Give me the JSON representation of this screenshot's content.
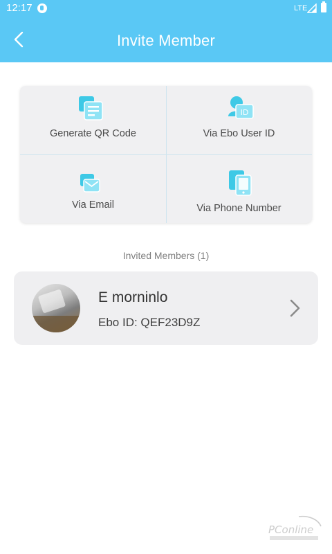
{
  "status_bar": {
    "time": "12:17",
    "network": "LTE",
    "icons": [
      "app-notification-icon",
      "signal-icon",
      "battery-icon"
    ]
  },
  "app_bar": {
    "title": "Invite Member",
    "back_icon": "chevron-left-icon"
  },
  "invite_options": [
    {
      "label": "Generate QR Code",
      "icon": "qr-code-icon"
    },
    {
      "label": "Via Ebo User ID",
      "icon": "user-id-icon"
    },
    {
      "label": "Via Email",
      "icon": "email-icon"
    },
    {
      "label": "Via Phone Number",
      "icon": "phone-icon"
    }
  ],
  "invited_section": {
    "heading": "Invited Members (1)",
    "members": [
      {
        "name": "E morninlo",
        "ebo_id": "Ebo ID: QEF23D9Z",
        "action_icon": "chevron-right-icon"
      }
    ]
  },
  "watermark": {
    "text": "PConline",
    "kind": "logo"
  },
  "colors": {
    "header": "#5ac8f5",
    "icon_accent": "#3ec9e6",
    "card_background": "#f0f0f2",
    "divider": "#cfe5ef"
  }
}
